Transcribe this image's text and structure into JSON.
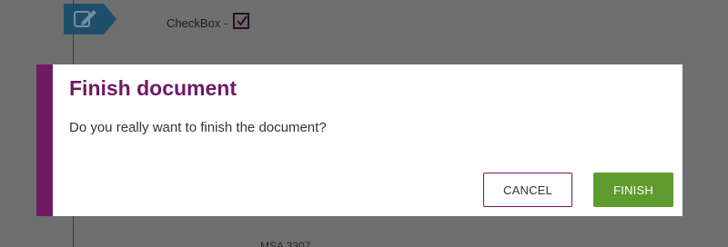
{
  "background": {
    "checkbox_label": "CheckBox -",
    "checkbox_checked": true,
    "bottom_text": "MSA 3307"
  },
  "dialog": {
    "title": "Finish document",
    "message": "Do you really want to finish the document?",
    "cancel_label": "CANCEL",
    "finish_label": "FINISH"
  },
  "colors": {
    "accent": "#6e1a64",
    "finish_button": "#5f9a2e",
    "overlay": "#6f6f6f"
  },
  "icons": {
    "edit_tag": "edit-icon",
    "checkmark": "check-icon"
  }
}
